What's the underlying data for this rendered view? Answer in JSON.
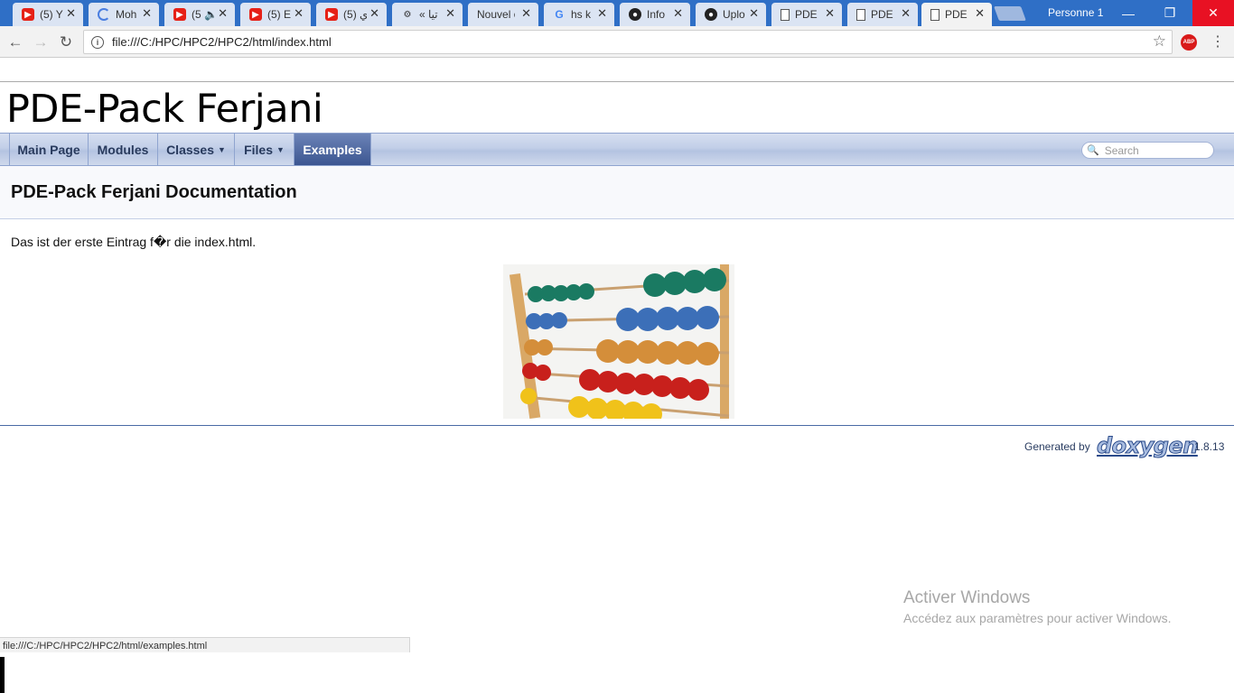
{
  "browser": {
    "tabs": [
      {
        "icon": "youtube-icon",
        "title": "(5) Y"
      },
      {
        "icon": "loading-spinner-icon",
        "title": "Moh"
      },
      {
        "icon": "youtube-icon",
        "title": "(5 🔈"
      },
      {
        "icon": "youtube-icon",
        "title": "(5) E"
      },
      {
        "icon": "youtube-icon",
        "title": "ي (5)"
      },
      {
        "icon": "page-icon",
        "title": "« تيا"
      },
      {
        "icon": "",
        "title": "Nouvel o"
      },
      {
        "icon": "google-icon",
        "title": "hs k"
      },
      {
        "icon": "github-icon",
        "title": "Info"
      },
      {
        "icon": "github-icon",
        "title": "Uplo"
      },
      {
        "icon": "document-icon",
        "title": "PDE"
      },
      {
        "icon": "document-icon",
        "title": "PDE"
      },
      {
        "icon": "document-icon",
        "title": "PDE"
      }
    ],
    "tab_close": "✕",
    "profile_name": "Personne 1",
    "window": {
      "minimize": "—",
      "restore": "❐",
      "close": "✕"
    },
    "address": "file:///C:/HPC/HPC2/HPC2/html/index.html",
    "info_glyph": "i",
    "star_glyph": "☆",
    "abp_label": "ABP",
    "menu_glyph": "⋮",
    "back_glyph": "←",
    "forward_glyph": "→",
    "reload_glyph": "↻"
  },
  "page": {
    "project_name": "PDE-Pack Ferjani",
    "nav": [
      {
        "label": "Main Page",
        "caret": ""
      },
      {
        "label": "Modules",
        "caret": ""
      },
      {
        "label": "Classes",
        "caret": "▼"
      },
      {
        "label": "Files",
        "caret": "▼"
      },
      {
        "label": "Examples",
        "caret": ""
      }
    ],
    "search_placeholder": "Search",
    "search_glyph": "🔍",
    "title": "PDE-Pack Ferjani Documentation",
    "body_text": "Das ist der erste Eintrag f�r die index.html.",
    "footer": {
      "generated_by": "Generated by",
      "logo_text": "doxygen",
      "version": "1.8.13"
    }
  },
  "status_url": "file:///C:/HPC/HPC2/HPC2/html/examples.html",
  "watermark": {
    "line1": "Activer Windows",
    "line2": "Accédez aux paramètres pour activer Windows."
  },
  "colors": {
    "titlebar": "#2f6fc6",
    "nav_selected": "#3c5691",
    "close_button": "#e81123"
  }
}
